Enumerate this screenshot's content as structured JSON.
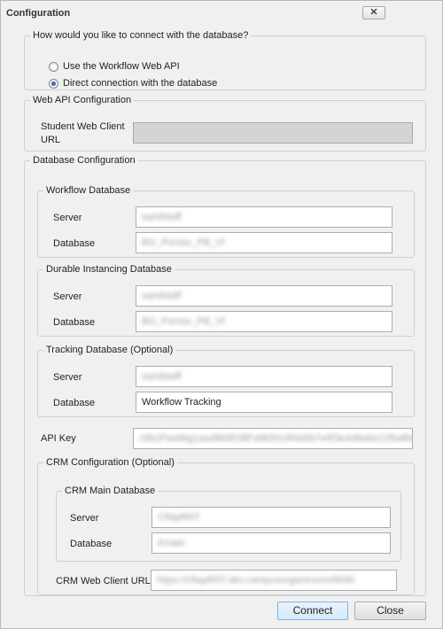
{
  "window": {
    "title": "Configuration",
    "close_glyph": "✕"
  },
  "connection": {
    "question": "How would you like to connect with the database?",
    "options": [
      {
        "label": "Use the Workflow Web API",
        "selected": false
      },
      {
        "label": "Direct connection with the database",
        "selected": true
      }
    ]
  },
  "web_api": {
    "legend": "Web API Configuration",
    "url_label_1": "Student Web Client",
    "url_label_2": "URL",
    "url_value": ""
  },
  "database": {
    "legend": "Database Configuration",
    "workflow": {
      "legend": "Workflow Database",
      "server_label": "Server",
      "server_value": "sandstaff",
      "database_label": "Database",
      "database_value": "BG_Pomax_PB_Vf"
    },
    "durable": {
      "legend": "Durable Instancing Database",
      "server_label": "Server",
      "server_value": "sandstaff",
      "database_label": "Database",
      "database_value": "BG_Pomax_PB_Vf"
    },
    "tracking": {
      "legend": "Tracking Database (Optional)",
      "server_label": "Server",
      "server_value": "sandstaff",
      "database_label": "Database",
      "database_value": "Workflow Tracking"
    },
    "api_key_label": "API Key",
    "api_key_value": "c9b2Fee6bg1aad8b9f1f8Fa9b50c9f4a5b7e6f3e4d8a6e21f6af8a37",
    "crm": {
      "legend": "CRM Configuration (Optional)",
      "main": {
        "legend": "CRM Main Database",
        "server_label": "Server",
        "server_value": "Cftapf65T",
        "database_label": "Database",
        "database_value": "Kmain"
      },
      "web_client_label": "CRM Web Client URL",
      "web_client_value": "https://cftapf65T.dev.campusorganicsom/8090"
    }
  },
  "footer": {
    "connect_label": "Connect",
    "close_label": "Close"
  }
}
